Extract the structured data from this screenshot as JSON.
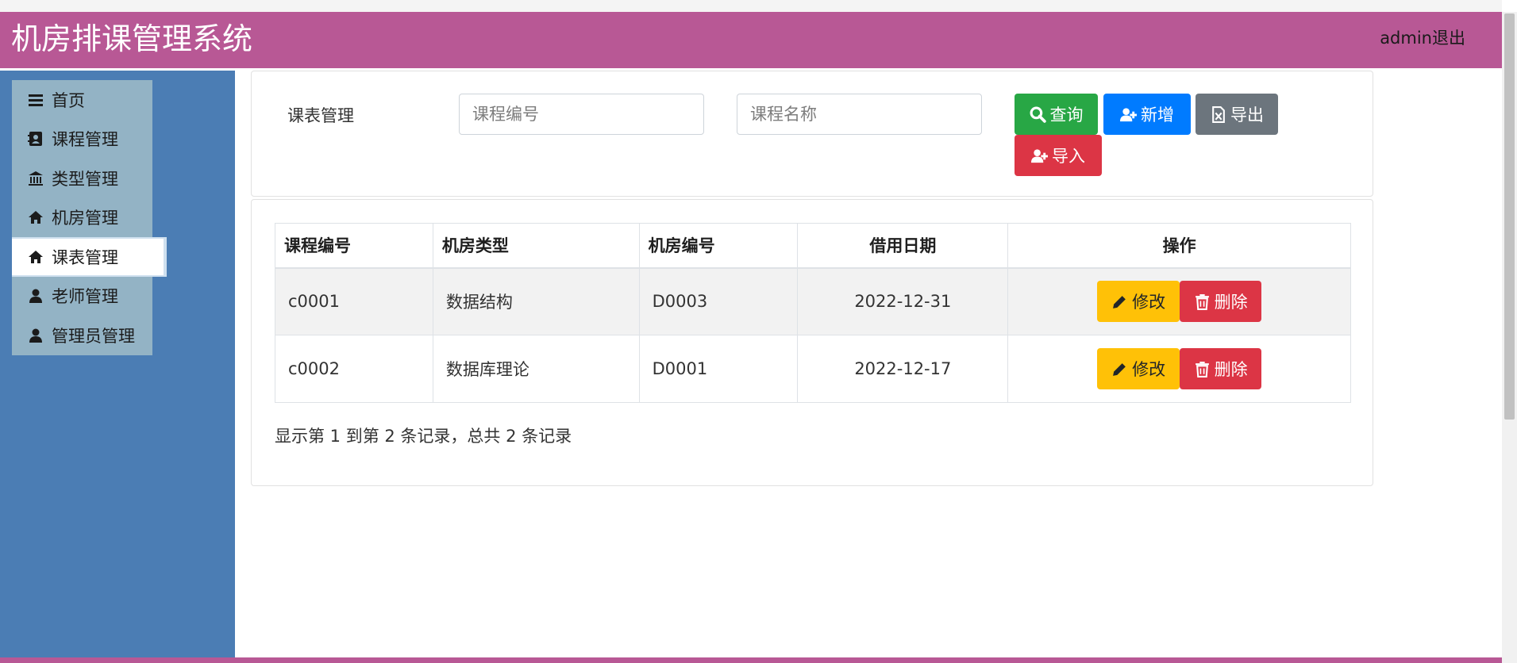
{
  "header": {
    "title": "机房排课管理系统",
    "user": "admin退出"
  },
  "sidebar": {
    "items": [
      {
        "label": "首页",
        "icon": "bars-icon"
      },
      {
        "label": "课程管理",
        "icon": "address-card-icon"
      },
      {
        "label": "类型管理",
        "icon": "bank-icon"
      },
      {
        "label": "机房管理",
        "icon": "home-icon"
      },
      {
        "label": "课表管理",
        "icon": "home-icon",
        "active": true
      },
      {
        "label": "老师管理",
        "icon": "user-icon"
      },
      {
        "label": "管理员管理",
        "icon": "user-icon"
      }
    ]
  },
  "search": {
    "label": "课表管理",
    "course_code_placeholder": "课程编号",
    "course_name_placeholder": "课程名称",
    "query_label": "查询",
    "add_label": "新增",
    "export_label": "导出",
    "import_label": "导入"
  },
  "table": {
    "headers": [
      "课程编号",
      "机房类型",
      "机房编号",
      "借用日期",
      "操作"
    ],
    "rows": [
      {
        "code": "c0001",
        "type": "数据结构",
        "room": "D0003",
        "date": "2022-12-31"
      },
      {
        "code": "c0002",
        "type": "数据库理论",
        "room": "D0001",
        "date": "2022-12-17"
      }
    ],
    "edit_label": "修改",
    "delete_label": "删除",
    "summary": "显示第 1 到第 2 条记录，总共 2 条记录"
  },
  "colors": {
    "header": "#b85895",
    "sidebar": "#4b7db4",
    "menu": "#93b3c5",
    "success": "#28a745",
    "primary": "#007bff",
    "secondary": "#6c757d",
    "danger": "#dc3545",
    "warning": "#ffc107"
  }
}
